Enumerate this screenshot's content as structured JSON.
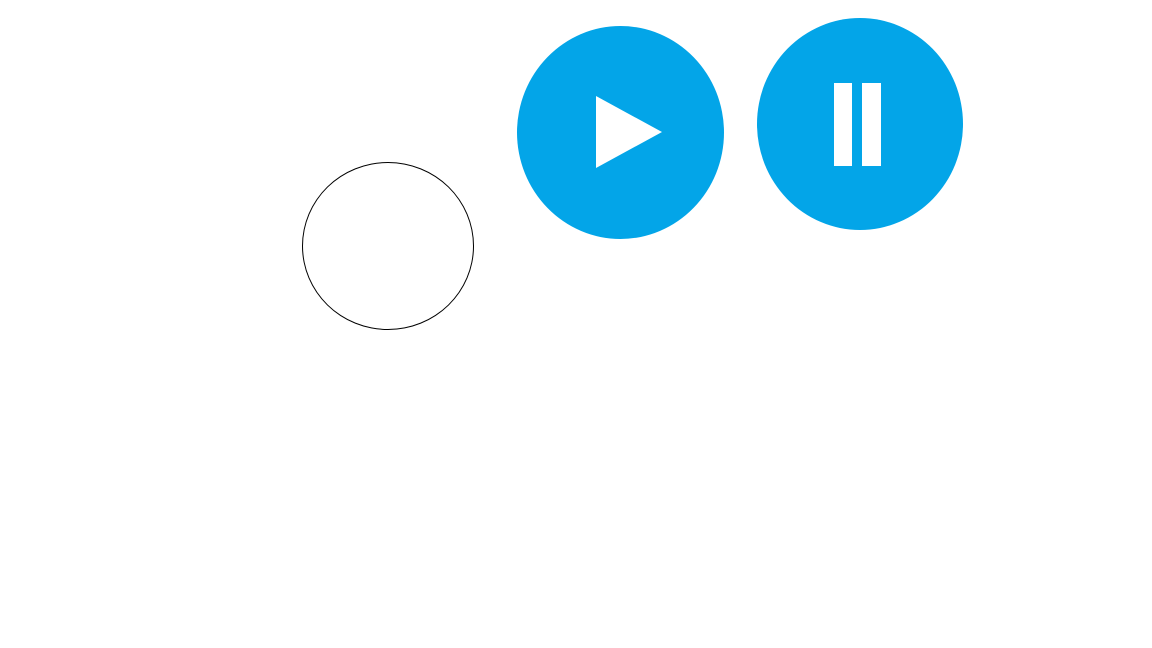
{
  "colors": {
    "button_fill": "#03A5E8",
    "button_glyph": "#FFFFFF",
    "outline_stroke": "#000000",
    "background": "#FFFFFF"
  },
  "controls": {
    "play_icon": "play-icon",
    "pause_icon": "pause-icon"
  }
}
